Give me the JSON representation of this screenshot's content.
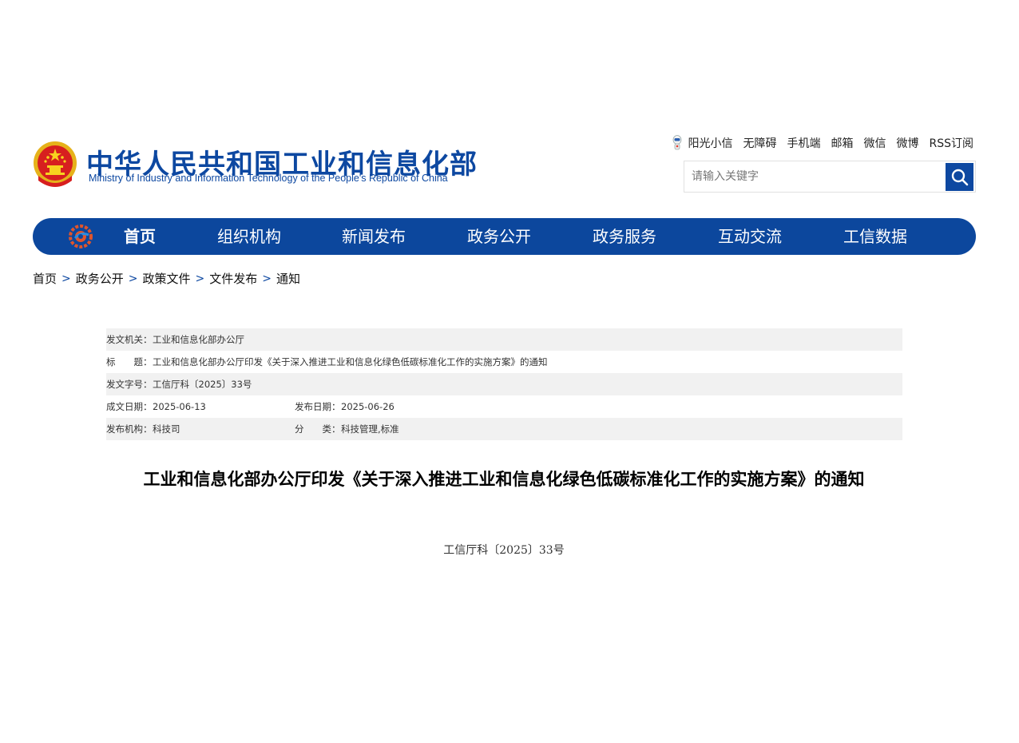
{
  "header": {
    "title_cn": "中华人民共和国工业和信息化部",
    "title_en": "Ministry of Industry and Information Technology of the People's Republic of China",
    "emblem_icon": "national-emblem-icon",
    "links": [
      {
        "label": "阳光小信"
      },
      {
        "label": "无障碍"
      },
      {
        "label": "手机端"
      },
      {
        "label": "邮箱"
      },
      {
        "label": "微信"
      },
      {
        "label": "微博"
      },
      {
        "label": "RSS订阅"
      }
    ],
    "search": {
      "placeholder": "请输入关键字",
      "value": ""
    }
  },
  "colors": {
    "brand": "#0c479d",
    "row_shade": "#f1f1f1"
  },
  "nav": {
    "items": [
      {
        "label": "首页"
      },
      {
        "label": "组织机构"
      },
      {
        "label": "新闻发布"
      },
      {
        "label": "政务公开"
      },
      {
        "label": "政务服务"
      },
      {
        "label": "互动交流"
      },
      {
        "label": "工信数据"
      }
    ]
  },
  "breadcrumb": {
    "items": [
      "首页",
      "政务公开",
      "政策文件",
      "文件发布",
      "通知"
    ],
    "separator": ">"
  },
  "meta": {
    "issuer_label": "发文机关：",
    "issuer": "工业和信息化部办公厅",
    "title_label": "标　　题：",
    "title": "工业和信息化部办公厅印发《关于深入推进工业和信息化绿色低碳标准化工作的实施方案》的通知",
    "docno_label": "发文字号：",
    "docno": "工信厅科〔2025〕33号",
    "created_label": "成文日期：",
    "created": "2025-06-13",
    "published_label": "发布日期：",
    "published": "2025-06-26",
    "org_label": "发布机构：",
    "org": "科技司",
    "category_label": "分　　类：",
    "category": "科技管理,标准"
  },
  "article": {
    "title": "工业和信息化部办公厅印发《关于深入推进工业和信息化绿色低碳标准化工作的实施方案》的通知",
    "doc_no": "工信厅科〔2025〕33号"
  }
}
